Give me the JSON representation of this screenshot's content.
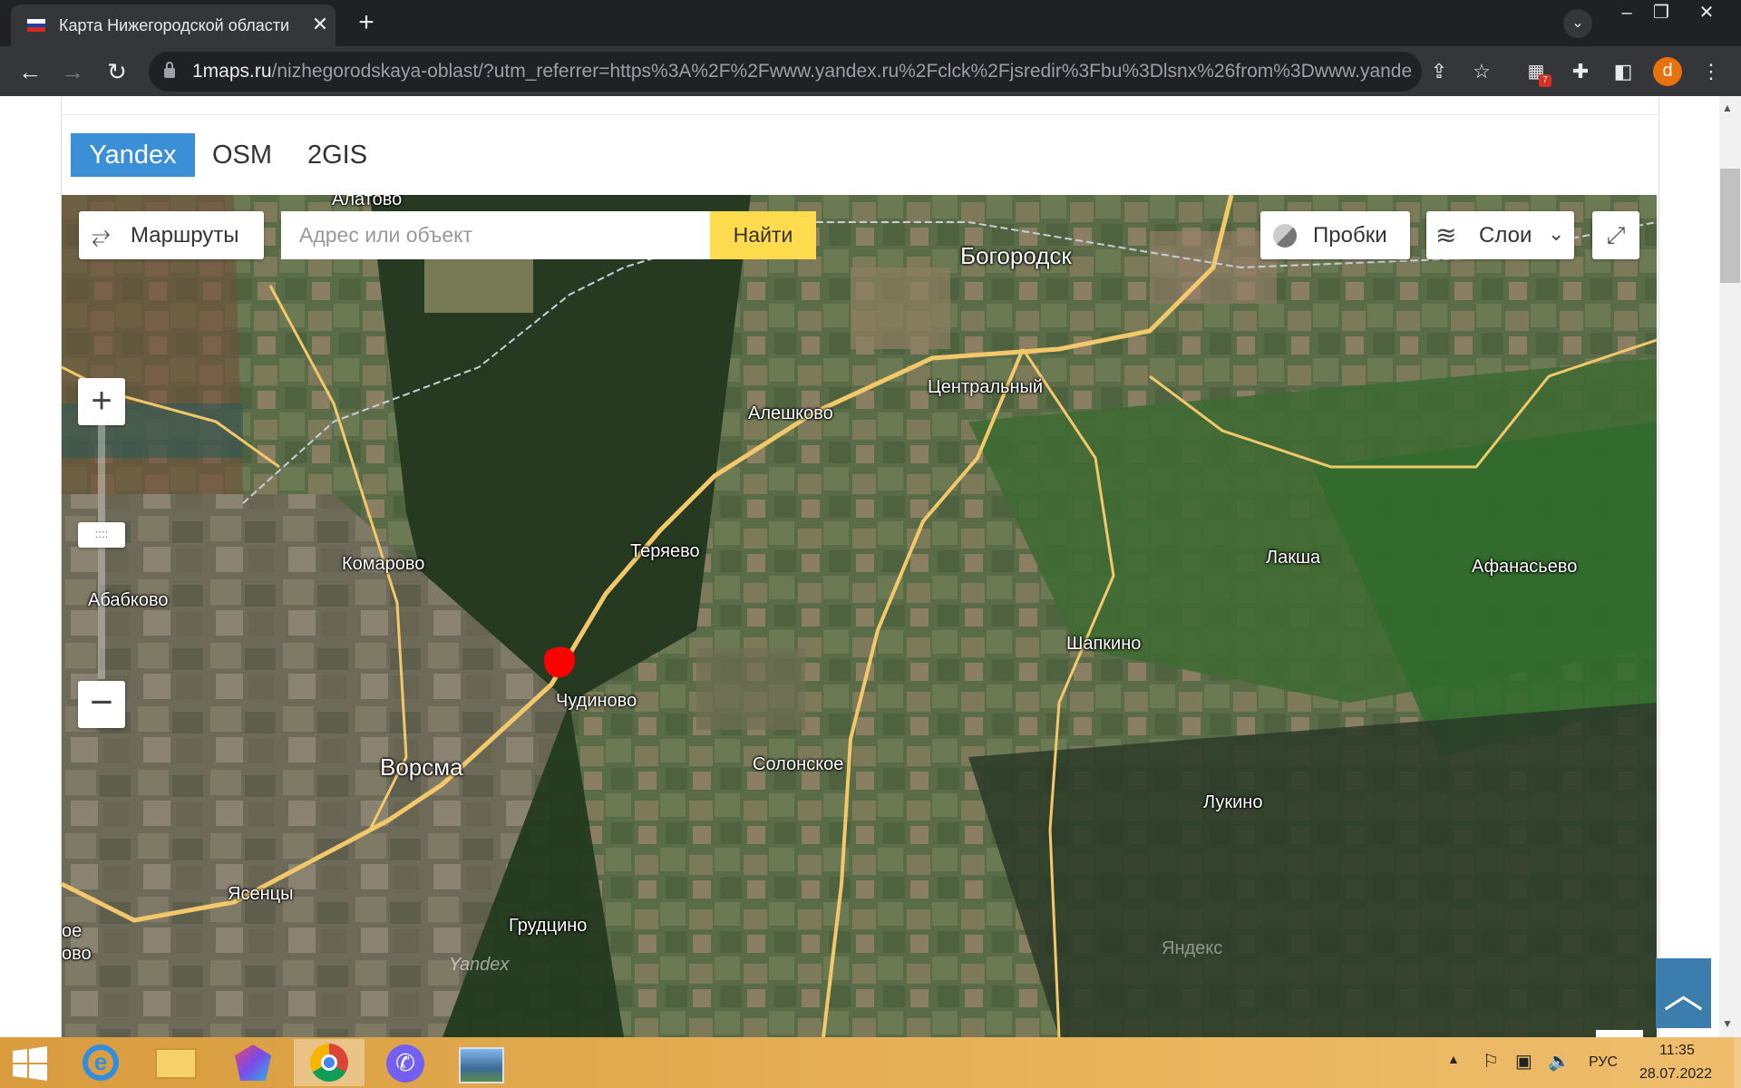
{
  "browser": {
    "tab_title": "Карта Нижегородской области",
    "tab_close": "✕",
    "new_tab": "+",
    "url_host": "1maps.ru",
    "url_path": "/nizhegorodskaya-oblast/?utm_referrer=https%3A%2F%2Fwww.yandex.ru%2Fclck%2Fjsredir%3Fbu%3Dlsnx%26from%3Dwww.yandex....",
    "profile_initial": "d",
    "extension_badge": "7"
  },
  "map_tabs": [
    "Yandex",
    "OSM",
    "2GIS"
  ],
  "map_controls": {
    "routes_label": "Маршруты",
    "search_placeholder": "Адрес или объект",
    "find_label": "Найти",
    "traffic_label": "Пробки",
    "layers_label": "Слои"
  },
  "places": [
    {
      "name": "Богородск",
      "size": "big"
    },
    {
      "name": "Центральный",
      "size": "normal"
    },
    {
      "name": "Алешково",
      "size": "normal"
    },
    {
      "name": "Теряево",
      "size": "normal"
    },
    {
      "name": "Комарово",
      "size": "normal"
    },
    {
      "name": "Абабково",
      "size": "normal"
    },
    {
      "name": "Чудиново",
      "size": "normal"
    },
    {
      "name": "Ворсма",
      "size": "big"
    },
    {
      "name": "Солонское",
      "size": "normal"
    },
    {
      "name": "Ясенцы",
      "size": "normal"
    },
    {
      "name": "Грудцино",
      "size": "normal"
    },
    {
      "name": "Шапкино",
      "size": "normal"
    },
    {
      "name": "Лакша",
      "size": "normal"
    },
    {
      "name": "Афанасьево",
      "size": "normal"
    },
    {
      "name": "Лукино",
      "size": "normal"
    },
    {
      "name": "ое",
      "size": "normal"
    },
    {
      "name": "ово",
      "size": "normal"
    },
    {
      "name": "Алатово",
      "size": "normal"
    }
  ],
  "watermarks": [
    "Yandex",
    "Яндекс"
  ],
  "taskbar": {
    "time": "11:35",
    "date": "28.07.2022",
    "language": "РУС"
  },
  "colors": {
    "yandex_tab_active": "#3b8fd6",
    "find_button": "#ffdb4d",
    "marker": "#ff0000",
    "road": "#f3c86b"
  }
}
